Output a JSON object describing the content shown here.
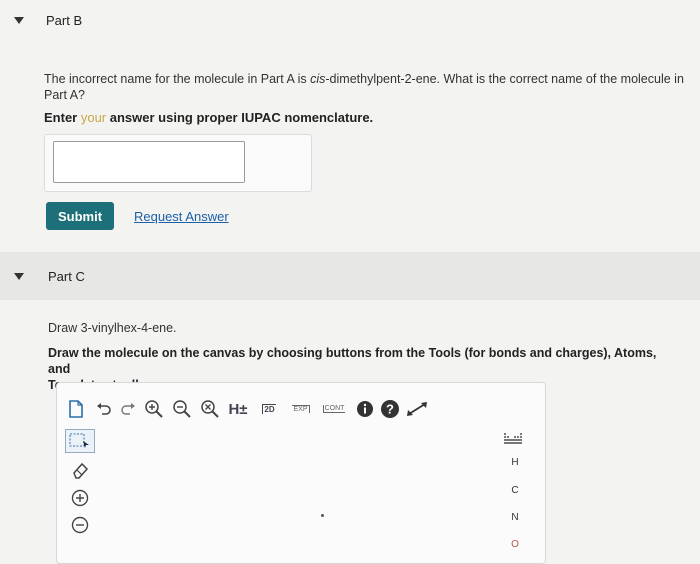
{
  "partB": {
    "title": "Part B",
    "question_line1_pre": "The incorrect name for the molecule in Part A is ",
    "question_line1_em": "cis",
    "question_line1_post": "-dimethylpent-2-ene. What is the correct name of the molecule in",
    "question_line2": "Part A?",
    "instruction_prefix": "Enter ",
    "instruction_faded": "your",
    "instruction_suffix": " answer using proper IUPAC nomenclature.",
    "answer_value": "",
    "submit_label": "Submit",
    "request_label": "Request Answer"
  },
  "partC": {
    "title": "Part C",
    "prompt": "Draw 3-vinylhex-4-ene.",
    "instruction_line1": "Draw the molecule on the canvas by choosing buttons from the Tools (for bonds and charges), Atoms, and",
    "instruction_line2": "Templates toolbars."
  },
  "toolbar": {
    "h_label": "H±",
    "icons": [
      "new-document-icon",
      "undo-icon",
      "redo-icon",
      "zoom-in-icon",
      "zoom-out-icon",
      "clear-icon",
      "explicit-hydrogens-icon",
      "2d-clean-icon",
      "expand-icon",
      "contract-icon",
      "info-icon",
      "help-icon",
      "fullscreen-icon"
    ],
    "label_2d": "2D",
    "label_exp": "EXP",
    "label_cont": "CONT"
  },
  "atoms": [
    "H",
    "C",
    "N",
    "O"
  ],
  "colors": {
    "accent": "#1d6f7a",
    "link": "#1d5fa8"
  }
}
